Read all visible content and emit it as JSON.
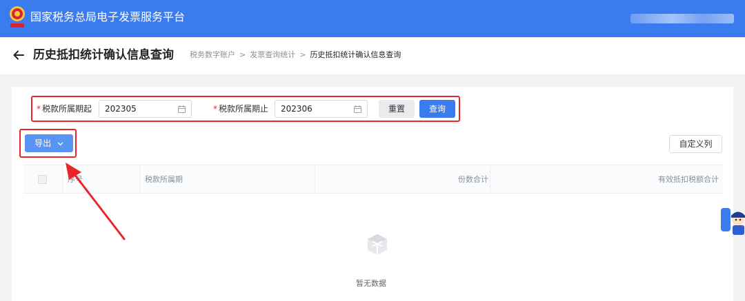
{
  "topbar": {
    "title": "国家税务总局电子发票服务平台",
    "logo_icon": "tax-emblem-icon",
    "user": ""
  },
  "header": {
    "back_icon": "arrow-left-icon",
    "title": "历史抵扣统计确认信息查询",
    "breadcrumb": [
      "税务数字账户",
      "发票查询统计",
      "历史抵扣统计确认信息查询"
    ],
    "separator": ">"
  },
  "filters": {
    "start_label": "税款所属期起",
    "start_value": "202305",
    "end_label": "税款所属期止",
    "end_value": "202306",
    "required_mark": "*",
    "calendar_icon": "calendar-icon",
    "reset_label": "重置",
    "query_label": "查询"
  },
  "toolbar": {
    "export_label": "导出",
    "export_icon": "chevron-down-icon",
    "custom_columns_label": "自定义列"
  },
  "table": {
    "columns": [
      "序号",
      "税款所属期",
      "份数合计",
      "有效抵扣税额合计"
    ]
  },
  "empty": {
    "text": "暂无数据",
    "icon": "empty-box-icon"
  },
  "annotation": {
    "color": "#e8262a"
  },
  "colors": {
    "brand": "#3b7bf0",
    "highlight": "#e8262a"
  }
}
